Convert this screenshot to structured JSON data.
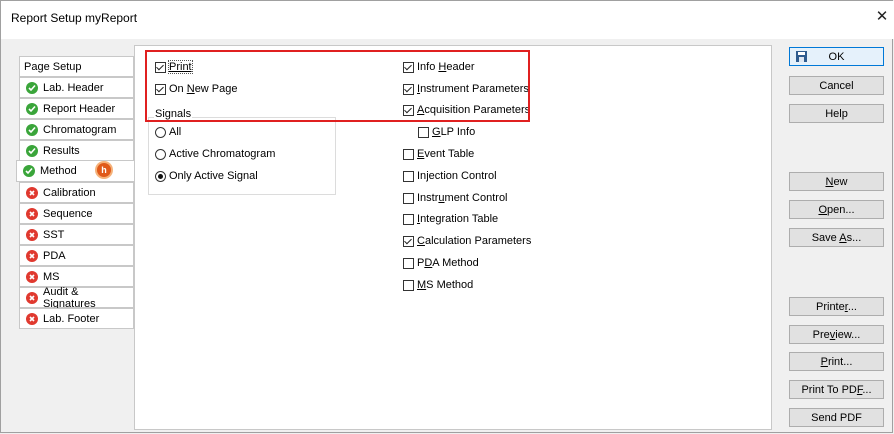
{
  "window": {
    "title": "Report Setup myReport",
    "close_glyph": "✕"
  },
  "tabs": [
    {
      "label": "Page Setup",
      "status": "none"
    },
    {
      "label": "Lab. Header",
      "status": "ok"
    },
    {
      "label": "Report Header",
      "status": "ok"
    },
    {
      "label": "Chromatogram",
      "status": "ok"
    },
    {
      "label": "Results",
      "status": "ok"
    },
    {
      "label": "Method",
      "status": "ok",
      "active": true,
      "badge": "h"
    },
    {
      "label": "Calibration",
      "status": "error"
    },
    {
      "label": "Sequence",
      "status": "error"
    },
    {
      "label": "SST",
      "status": "error"
    },
    {
      "label": "PDA",
      "status": "error"
    },
    {
      "label": "MS",
      "status": "error"
    },
    {
      "label": "Audit & Signatures",
      "status": "error"
    },
    {
      "label": "Lab. Footer",
      "status": "error"
    }
  ],
  "method": {
    "print": {
      "label": "Print",
      "checked": true
    },
    "on_new_page": {
      "label_pre": "On ",
      "label_u": "N",
      "label_post": "ew Page",
      "checked": true
    },
    "signals": {
      "label": "Signals",
      "options": [
        "All",
        "Active Chromatogram",
        "Only Active Signal"
      ],
      "selected": "Only Active Signal"
    },
    "right_options": [
      {
        "pre": "Info ",
        "u": "H",
        "post": "eader",
        "checked": true
      },
      {
        "pre": "",
        "u": "I",
        "post": "nstrument Parameters",
        "checked": true
      },
      {
        "pre": "",
        "u": "A",
        "post": "cquisition Parameters",
        "checked": true
      },
      {
        "pre": "",
        "u": "G",
        "post": "LP Info",
        "checked": false
      },
      {
        "pre": "",
        "u": "E",
        "post": "vent Table",
        "checked": false
      },
      {
        "pre": "In",
        "u": "j",
        "post": "ection Control",
        "checked": false
      },
      {
        "pre": "Instr",
        "u": "u",
        "post": "ment Control",
        "checked": false
      },
      {
        "pre": "",
        "u": "I",
        "post": "ntegration Table",
        "checked": false
      },
      {
        "pre": "",
        "u": "C",
        "post": "alculation Parameters",
        "checked": true
      },
      {
        "pre": "P",
        "u": "D",
        "post": "A Method",
        "checked": false
      },
      {
        "pre": "",
        "u": "M",
        "post": "S Method",
        "checked": false
      }
    ]
  },
  "buttons": {
    "ok": "OK",
    "cancel": "Cancel",
    "help": "Help",
    "new": {
      "pre": "",
      "u": "N",
      "post": "ew"
    },
    "open": {
      "pre": "",
      "u": "O",
      "post": "pen..."
    },
    "save_as": {
      "pre": "Save ",
      "u": "A",
      "post": "s..."
    },
    "printer": {
      "pre": "Printe",
      "u": "r",
      "post": "..."
    },
    "preview": {
      "pre": "Pre",
      "u": "v",
      "post": "iew..."
    },
    "print": {
      "pre": "",
      "u": "P",
      "post": "rint..."
    },
    "print_to_pdf": {
      "pre": "Print To PD",
      "u": "F",
      "post": "..."
    },
    "send_pdf": "Send PDF"
  },
  "colors": {
    "highlight": "#e02020",
    "ok_icon": "#3aa53a",
    "error_icon": "#e0392f",
    "badge": "#e05a1a"
  }
}
